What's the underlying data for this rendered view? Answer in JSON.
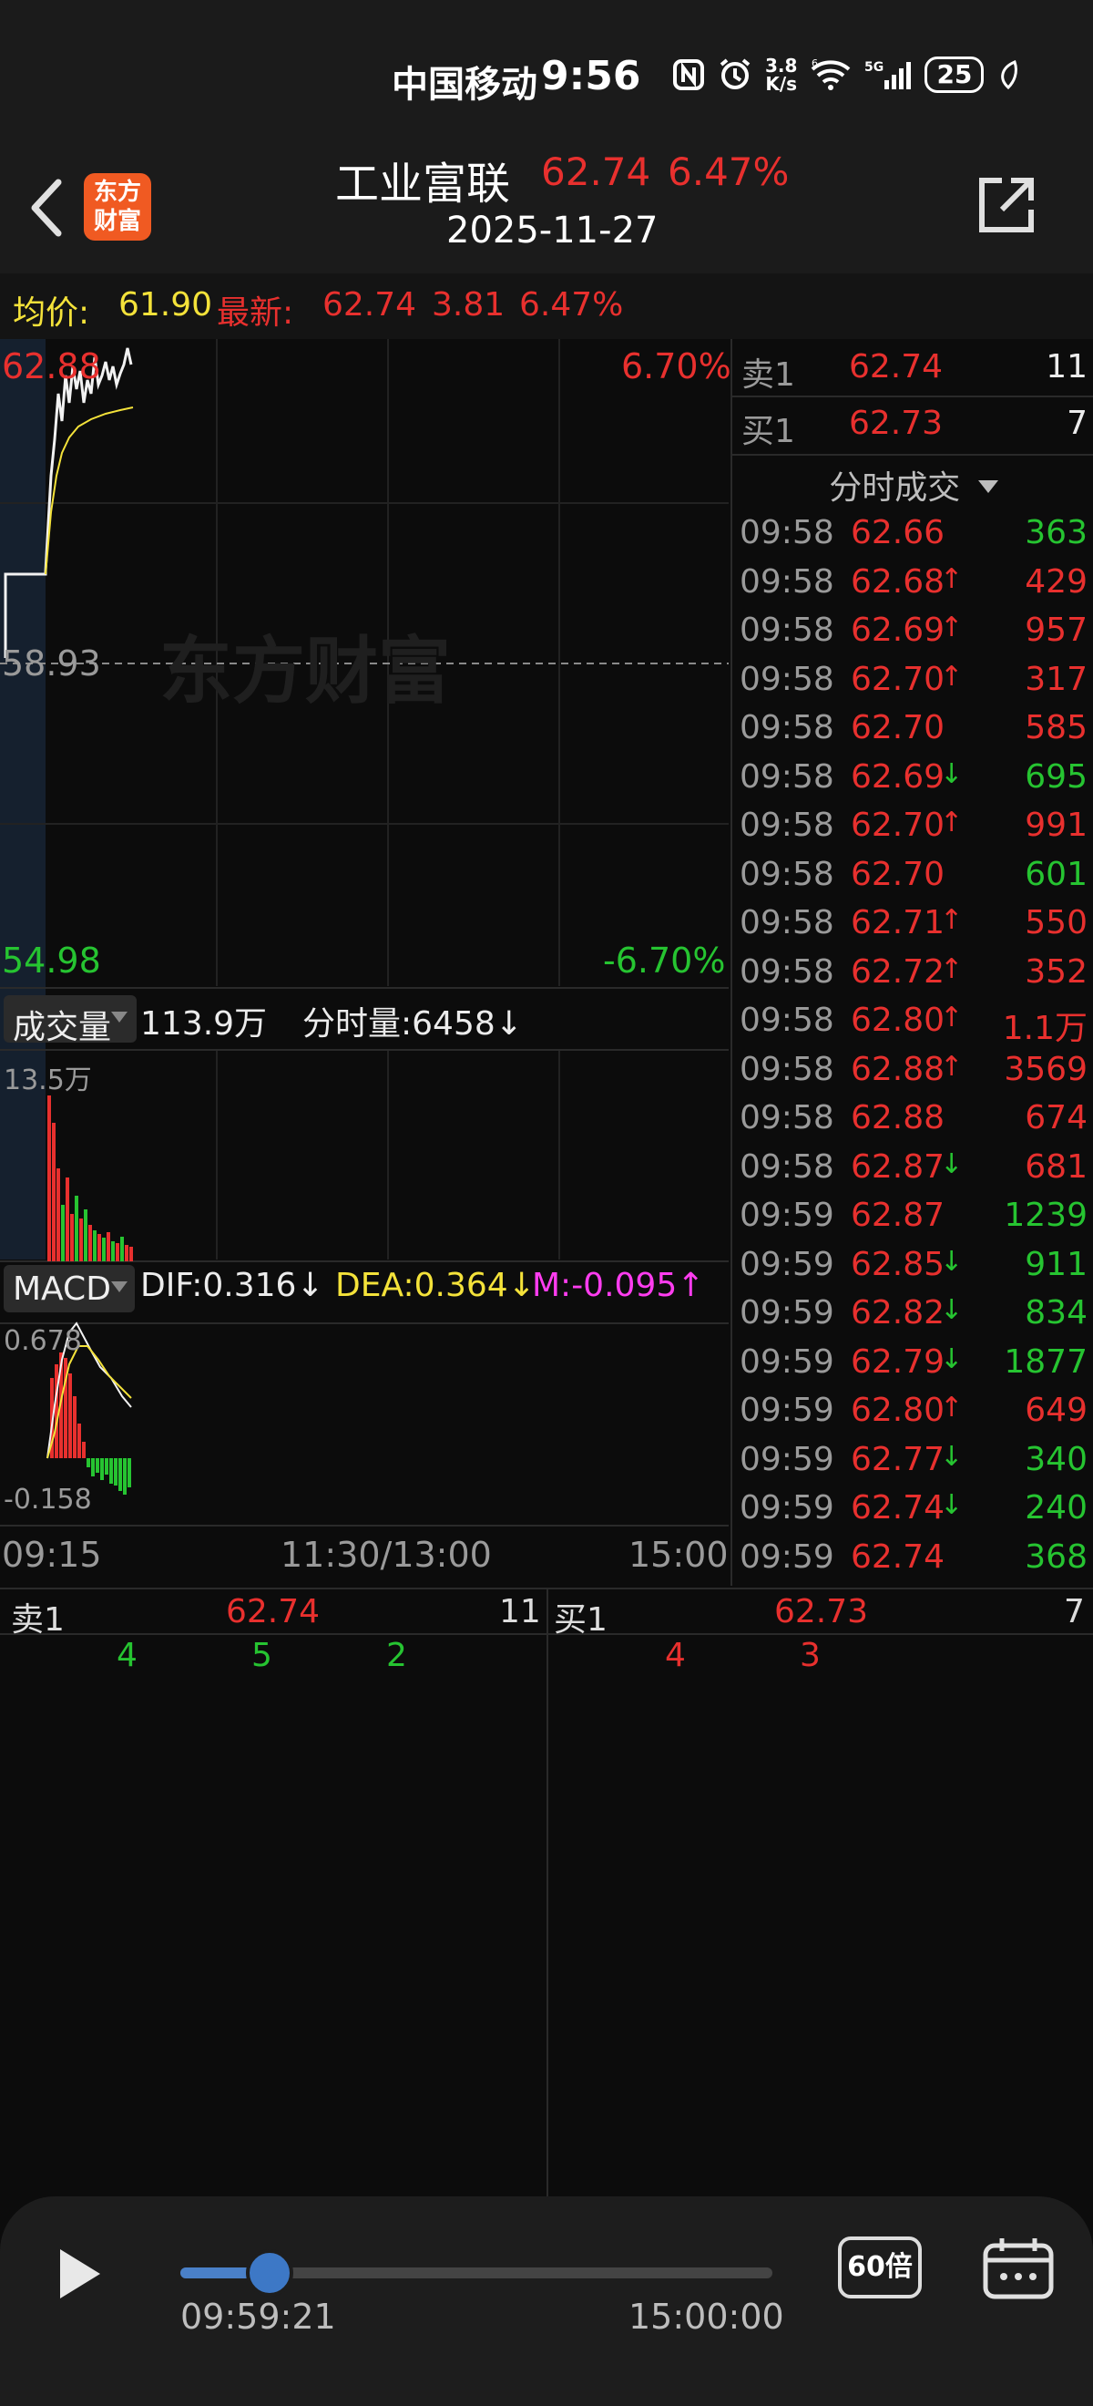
{
  "status_bar": {
    "carrier": "中国移动",
    "time": "9:56",
    "speed_top": "3.8",
    "speed_unit": "K/s",
    "battery": "25"
  },
  "header": {
    "logo_line1": "东方",
    "logo_line2": "财富",
    "stock_name": "工业富联",
    "price": "62.74",
    "change_pct": "6.47%",
    "date": "2025-11-27"
  },
  "info_bar": {
    "avg_label": "均价:",
    "avg_value": "61.90",
    "latest_label": "最新:",
    "latest_value": "62.74",
    "change": "3.81",
    "change_pct": "6.47%"
  },
  "price_chart": {
    "high_price": "62.88",
    "base_price": "58.93",
    "low_price": "54.98",
    "high_pct": "6.70%",
    "low_pct": "-6.70%",
    "watermark": "东方财富"
  },
  "volume_panel": {
    "label": "成交量",
    "total": "113.9万",
    "tick_volume": "分时量:6458↓",
    "max_label": "13.5万"
  },
  "macd_panel": {
    "label": "MACD",
    "dif": "DIF:0.316↓",
    "dea": "DEA:0.364↓",
    "m": "M:-0.095↑",
    "max_label": "0.678",
    "min_label": "-0.158"
  },
  "time_axis": {
    "start": "09:15",
    "mid": "11:30/13:00",
    "end": "15:00"
  },
  "quotes": {
    "sell1_label": "卖1",
    "sell1_price": "62.74",
    "sell1_volume": "11",
    "buy1_label": "买1",
    "buy1_price": "62.73",
    "buy1_volume": "7"
  },
  "trades": {
    "header": "分时成交",
    "rows": [
      {
        "time": "09:58",
        "price": "62.66",
        "arrow": "",
        "volume": "363",
        "vol_color": "green"
      },
      {
        "time": "09:58",
        "price": "62.68",
        "arrow": "↑",
        "volume": "429",
        "vol_color": "red"
      },
      {
        "time": "09:58",
        "price": "62.69",
        "arrow": "↑",
        "volume": "957",
        "vol_color": "red"
      },
      {
        "time": "09:58",
        "price": "62.70",
        "arrow": "↑",
        "volume": "317",
        "vol_color": "red"
      },
      {
        "time": "09:58",
        "price": "62.70",
        "arrow": "",
        "volume": "585",
        "vol_color": "red"
      },
      {
        "time": "09:58",
        "price": "62.69",
        "arrow": "↓",
        "volume": "695",
        "vol_color": "green"
      },
      {
        "time": "09:58",
        "price": "62.70",
        "arrow": "↑",
        "volume": "991",
        "vol_color": "red"
      },
      {
        "time": "09:58",
        "price": "62.70",
        "arrow": "",
        "volume": "601",
        "vol_color": "green"
      },
      {
        "time": "09:58",
        "price": "62.71",
        "arrow": "↑",
        "volume": "550",
        "vol_color": "red"
      },
      {
        "time": "09:58",
        "price": "62.72",
        "arrow": "↑",
        "volume": "352",
        "vol_color": "red"
      },
      {
        "time": "09:58",
        "price": "62.80",
        "arrow": "↑",
        "volume": "1.1万",
        "vol_color": "red"
      },
      {
        "time": "09:58",
        "price": "62.88",
        "arrow": "↑",
        "volume": "3569",
        "vol_color": "red"
      },
      {
        "time": "09:58",
        "price": "62.88",
        "arrow": "",
        "volume": "674",
        "vol_color": "red"
      },
      {
        "time": "09:58",
        "price": "62.87",
        "arrow": "↓",
        "volume": "681",
        "vol_color": "red"
      },
      {
        "time": "09:59",
        "price": "62.87",
        "arrow": "",
        "volume": "1239",
        "vol_color": "green"
      },
      {
        "time": "09:59",
        "price": "62.85",
        "arrow": "↓",
        "volume": "911",
        "vol_color": "green"
      },
      {
        "time": "09:59",
        "price": "62.82",
        "arrow": "↓",
        "volume": "834",
        "vol_color": "green"
      },
      {
        "time": "09:59",
        "price": "62.79",
        "arrow": "↓",
        "volume": "1877",
        "vol_color": "green"
      },
      {
        "time": "09:59",
        "price": "62.80",
        "arrow": "↑",
        "volume": "649",
        "vol_color": "red"
      },
      {
        "time": "09:59",
        "price": "62.77",
        "arrow": "↓",
        "volume": "340",
        "vol_color": "green"
      },
      {
        "time": "09:59",
        "price": "62.74",
        "arrow": "↓",
        "volume": "240",
        "vol_color": "green"
      },
      {
        "time": "09:59",
        "price": "62.74",
        "arrow": "",
        "volume": "368",
        "vol_color": "green"
      }
    ]
  },
  "order_book": {
    "sell_label": "卖1",
    "sell_price": "62.74",
    "sell_volume": "11",
    "sell_orders": [
      "4",
      "5",
      "2"
    ],
    "buy_label": "买1",
    "buy_price": "62.73",
    "buy_volume": "7",
    "buy_orders": [
      "4",
      "3"
    ]
  },
  "playback": {
    "current_time": "09:59:21",
    "end_time": "15:00:00",
    "speed_label": "60倍",
    "progress": 0.15
  },
  "colors": {
    "up": "#e8302e",
    "down": "#26c431",
    "avg_line": "#f4e23a",
    "accent": "#3d78c6",
    "brand": "#f05a22"
  }
}
